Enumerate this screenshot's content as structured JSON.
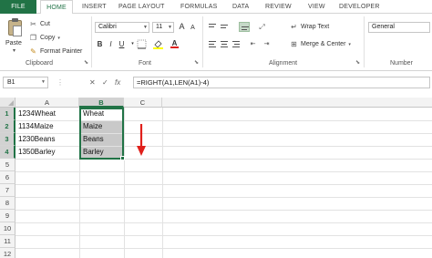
{
  "ribbon_tabs": [
    "FILE",
    "HOME",
    "INSERT",
    "PAGE LAYOUT",
    "FORMULAS",
    "DATA",
    "REVIEW",
    "VIEW",
    "DEVELOPER"
  ],
  "active_tab": "HOME",
  "clipboard": {
    "paste_label": "Paste",
    "cut_label": "Cut",
    "copy_label": "Copy",
    "format_painter_label": "Format Painter",
    "group_label": "Clipboard"
  },
  "font": {
    "font_name": "Calibri",
    "font_size": "11",
    "group_label": "Font",
    "bold": "B",
    "italic": "I",
    "underline": "U",
    "grow": "A",
    "shrink": "A",
    "font_color": "A"
  },
  "alignment": {
    "wrap_text_label": "Wrap Text",
    "merge_center_label": "Merge & Center",
    "group_label": "Alignment"
  },
  "number": {
    "format": "General",
    "group_label": "Number"
  },
  "formula_bar": {
    "name_box": "B1",
    "cancel": "✕",
    "enter": "✓",
    "fx": "fx",
    "formula": "=RIGHT(A1,LEN(A1)-4)"
  },
  "sheet": {
    "columns": [
      "A",
      "B",
      "C"
    ],
    "rows": [
      "1",
      "2",
      "3",
      "4",
      "5",
      "6",
      "7",
      "8",
      "9",
      "10",
      "11",
      "12"
    ],
    "col_a": [
      "1234Wheat",
      "1134Maize",
      "1230Beans",
      "1350Barley"
    ],
    "col_b": [
      "Wheat",
      "Maize",
      "Beans",
      "Barley"
    ]
  },
  "colors": {
    "excel_green": "#217346",
    "arrow_red": "#e0201b",
    "selection_gray": "#c9c9c9"
  }
}
